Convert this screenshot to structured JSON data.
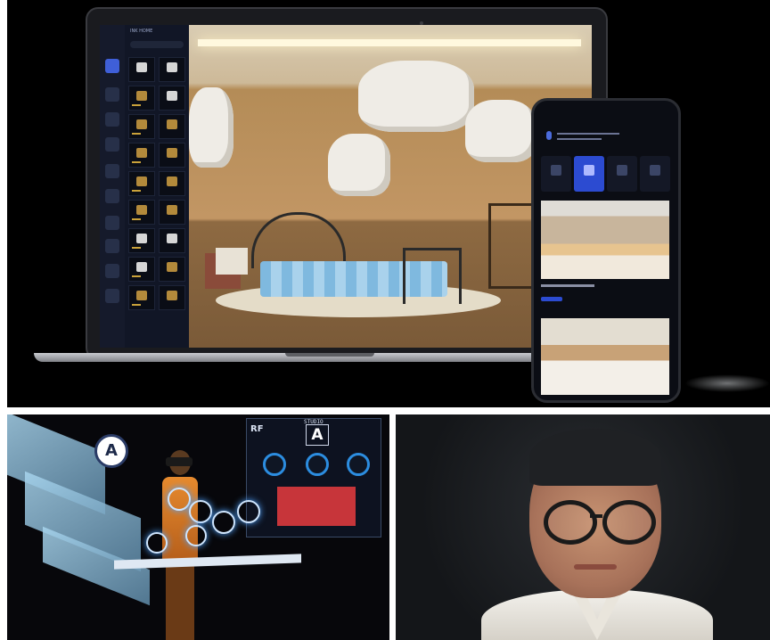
{
  "laptop": {
    "app_brand": "INK HOME",
    "viewport_scene": "room"
  },
  "phone": {
    "title": ""
  },
  "vr_panel": {
    "hud_label": "STUDIO",
    "hud_letter": "A",
    "hud_side": "RF",
    "badge_letter": "A"
  },
  "colors": {
    "accent": "#2c4bd1",
    "hud_red": "#c7353a",
    "background": "#000000"
  }
}
